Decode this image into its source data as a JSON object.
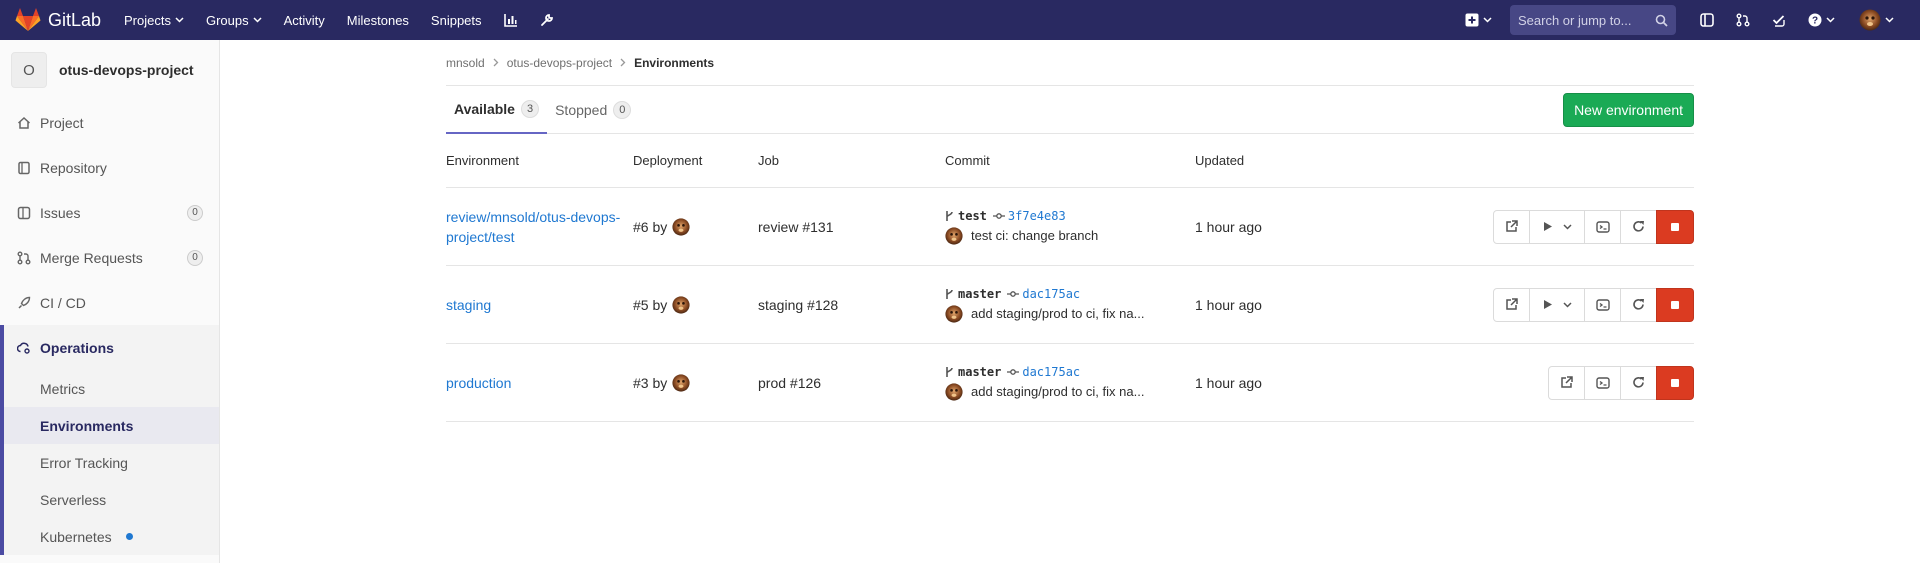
{
  "topnav": {
    "brand": "GitLab",
    "links": [
      "Projects",
      "Groups",
      "Activity",
      "Milestones",
      "Snippets"
    ],
    "search_placeholder": "Search or jump to..."
  },
  "sidebar": {
    "project_initial": "O",
    "project_name": "otus-devops-project",
    "items": [
      {
        "label": "Project",
        "icon": "home-icon"
      },
      {
        "label": "Repository",
        "icon": "book-icon"
      },
      {
        "label": "Issues",
        "icon": "issues-icon",
        "count": "0"
      },
      {
        "label": "Merge Requests",
        "icon": "merge-request-icon",
        "count": "0"
      },
      {
        "label": "CI / CD",
        "icon": "rocket-icon"
      }
    ],
    "operations": {
      "label": "Operations",
      "subitems": [
        "Metrics",
        "Environments",
        "Error Tracking",
        "Serverless",
        "Kubernetes"
      ]
    }
  },
  "breadcrumb": [
    "mnsold",
    "otus-devops-project",
    "Environments"
  ],
  "tabs": [
    {
      "label": "Available",
      "count": "3"
    },
    {
      "label": "Stopped",
      "count": "0"
    }
  ],
  "new_env_button": "New environment",
  "table": {
    "headers": [
      "Environment",
      "Deployment",
      "Job",
      "Commit",
      "Updated"
    ],
    "rows": [
      {
        "env_line1": "review/mnsold/otus-devops-",
        "env_line2": "project/test",
        "deployment": "#6 by",
        "job": "review #131",
        "ref": "test",
        "sha": "3f7e4e83",
        "message": "test ci: change branch",
        "updated": "1 hour ago"
      },
      {
        "env_line1": "staging",
        "env_line2": "",
        "deployment": "#5 by",
        "job": "staging #128",
        "ref": "master",
        "sha": "dac175ac",
        "message": "add staging/prod to ci, fix na...",
        "updated": "1 hour ago"
      },
      {
        "env_line1": "production",
        "env_line2": "",
        "deployment": "#3 by",
        "job": "prod #126",
        "ref": "master",
        "sha": "dac175ac",
        "message": "add staging/prod to ci, fix na...",
        "updated": "1 hour ago"
      }
    ]
  },
  "colors": {
    "nav_bg": "#292961",
    "link": "#1f78d1",
    "success": "#1aaa55",
    "danger": "#db3b21"
  }
}
